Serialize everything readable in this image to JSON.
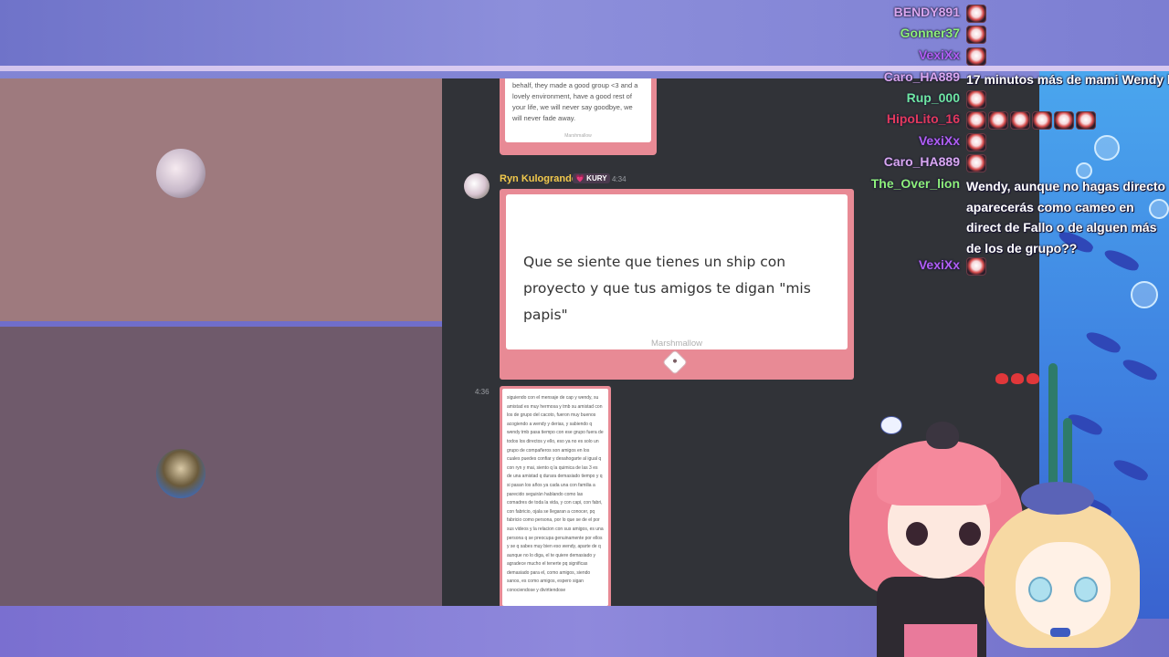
{
  "discord": {
    "card_top_text": "behalf, they made a good group <3 and a lovely environment, have a good rest of your life, we will never say goodbye, we will never fade away.",
    "card_top_footer": "Marshmallow",
    "username": "Ryn Kulogrande",
    "role_badge": "💗 KURY",
    "timestamp": "4:34",
    "main_message": "Que se siente que tienes un ship con proyecto y que tus amigos te digan \"mis papis\"",
    "main_footer": "Marshmallow",
    "timestamp2": "4:36",
    "card_bottom_text": "siguiendo con el mensaje de cap y wendy, su amistad es muy hermosa y tmb su amistad con los de grupo del cacoto, fueron muy buenos acogiendo a wendy y derias, y sabiendo q wendy tmb pasa tiempo con ese grupo fuera de todos los directos y ello, eso ya no es solo un grupo de compañeros son amigos en los cuales puedes confiar y desahogarte al igual q con ryn y mai, siento q la quimica de las 3 es de una amistad q durara demasiado tiempo y q si pasan los años ya cada una con familia a parecido seguirán hablando como las comadres de toda la vida, y con capi, con fabri, con fabricio, ojala se llegaran a conocer, pq fabricio como persona, por lo que se de el por sus videos y la relacion con sus amigos, es una persona q se preocupa genuinamente por ellos y se q sabes muy bien eso wendy, aparte de q aunque no lo diga, el te quiere demasiado y agradece mucho el tenerte pq significas demasiado para el, como amigos, siendo sanos, es como amigos, espero sigan conociendose y divirtiendose"
  },
  "chat": [
    {
      "name": "BENDY891",
      "color": "#d9a7f0",
      "message": "",
      "emotes": 1
    },
    {
      "name": "Gonner37",
      "color": "#8ef07a",
      "message": "",
      "emotes": 1
    },
    {
      "name": "VexiXx",
      "color": "#b15ef5",
      "message": "",
      "emotes": 1
    },
    {
      "name": "Caro_HA889",
      "color": "#d9a7f0",
      "message": "17 minutos más de mami Wendy b",
      "emotes": 0
    },
    {
      "name": "Rup_000",
      "color": "#6fe8a0",
      "message": "",
      "emotes": 1
    },
    {
      "name": "HipoLito_16",
      "color": "#e33a5a",
      "message": "",
      "emotes": 6
    },
    {
      "name": "VexiXx",
      "color": "#b15ef5",
      "message": "",
      "emotes": 1
    },
    {
      "name": "Caro_HA889",
      "color": "#d9a7f0",
      "message": "",
      "emotes": 1
    },
    {
      "name": "The_Over_lion",
      "color": "#8ef07a",
      "message": "Wendy, aunque no hagas directo aparecerás como cameo en direct de Fallo o de alguen más de los de grupo??",
      "emotes": 0
    },
    {
      "name": "VexiXx",
      "color": "#b15ef5",
      "message": "",
      "emotes": 1
    }
  ]
}
